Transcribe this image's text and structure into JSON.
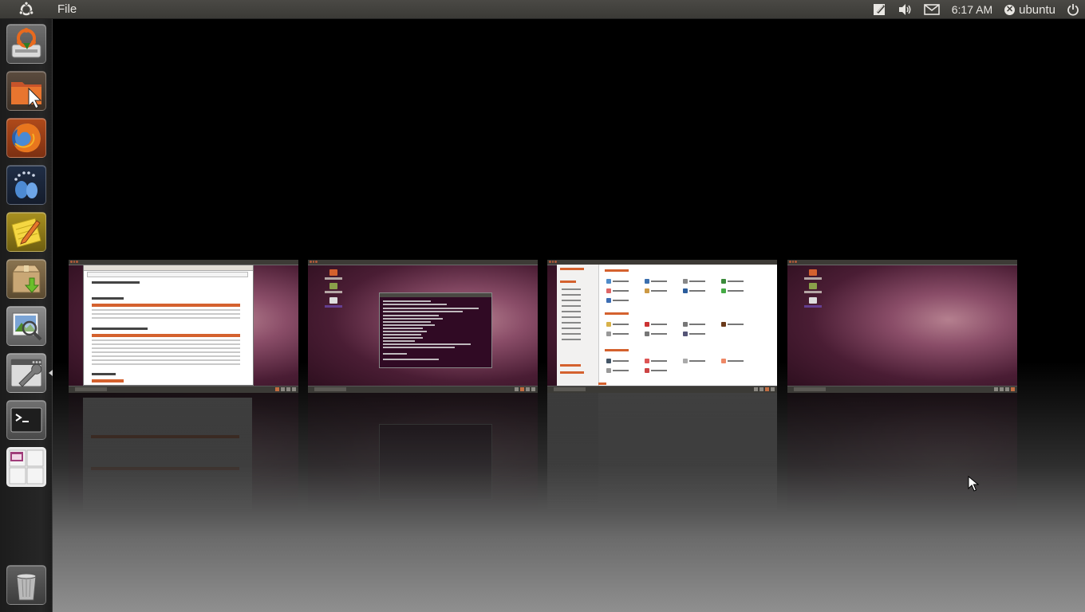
{
  "top_panel": {
    "app_menu": "File",
    "indicators": {
      "clock": "6:17 AM",
      "user": "ubuntu"
    },
    "icons": [
      "ubuntu-logo-icon",
      "notes-icon",
      "volume-icon",
      "mail-icon",
      "power-icon"
    ]
  },
  "launcher": {
    "items": [
      {
        "name": "Ubuntu Software Center",
        "icon": "installer-icon"
      },
      {
        "name": "Home Folder",
        "icon": "home-folder-icon"
      },
      {
        "name": "Firefox Web Browser",
        "icon": "firefox-icon"
      },
      {
        "name": "Empathy",
        "icon": "empathy-icon"
      },
      {
        "name": "Text Editor",
        "icon": "text-editor-icon"
      },
      {
        "name": "Archive Manager",
        "icon": "archive-icon"
      },
      {
        "name": "Image Viewer",
        "icon": "image-viewer-icon"
      },
      {
        "name": "System Settings",
        "icon": "system-settings-icon",
        "active": true
      },
      {
        "name": "Terminal",
        "icon": "terminal-icon"
      },
      {
        "name": "Workspace Switcher",
        "icon": "workspace-switcher-icon"
      }
    ],
    "trash": {
      "name": "Trash",
      "icon": "trash-icon"
    }
  },
  "workspaces": [
    {
      "name": "workspace-1",
      "content": "browser"
    },
    {
      "name": "workspace-2",
      "content": "terminal"
    },
    {
      "name": "workspace-3",
      "content": "control-center"
    },
    {
      "name": "workspace-4",
      "content": "empty-desktop"
    }
  ],
  "colors": {
    "panel": "#3b3a36",
    "accent": "#dd4814",
    "terminal_bg": "#300a24"
  }
}
